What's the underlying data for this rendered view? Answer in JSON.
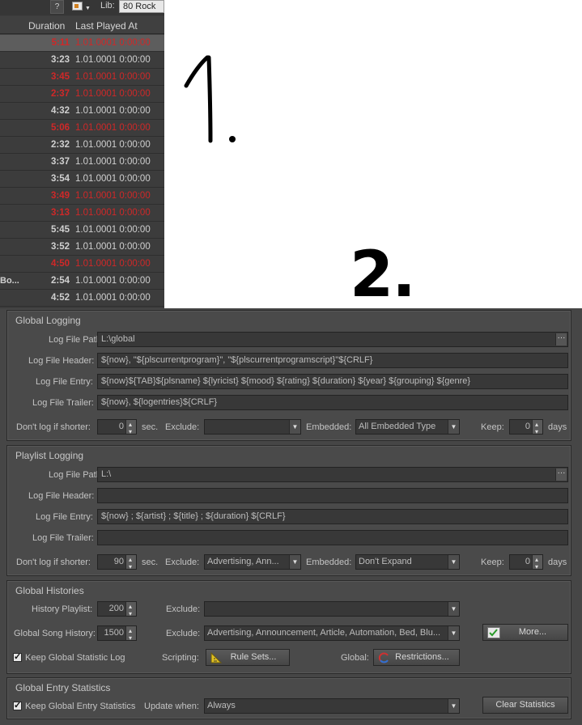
{
  "library": {
    "help_label": "?",
    "lib_label": "Lib:",
    "lib_value": "80 Rock",
    "columns": {
      "duration": "Duration",
      "last_played": "Last Played At"
    },
    "rows": [
      {
        "track": "",
        "duration": "5:11",
        "last_played": "1.01.0001 0:00:00",
        "red": true,
        "selected": true
      },
      {
        "track": "",
        "duration": "3:23",
        "last_played": "1.01.0001 0:00:00",
        "red": false
      },
      {
        "track": "",
        "duration": "3:45",
        "last_played": "1.01.0001 0:00:00",
        "red": true
      },
      {
        "track": "",
        "duration": "2:37",
        "last_played": "1.01.0001 0:00:00",
        "red": true
      },
      {
        "track": "",
        "duration": "4:32",
        "last_played": "1.01.0001 0:00:00",
        "red": false
      },
      {
        "track": "",
        "duration": "5:06",
        "last_played": "1.01.0001 0:00:00",
        "red": true
      },
      {
        "track": "",
        "duration": "2:32",
        "last_played": "1.01.0001 0:00:00",
        "red": false
      },
      {
        "track": "",
        "duration": "3:37",
        "last_played": "1.01.0001 0:00:00",
        "red": false
      },
      {
        "track": "",
        "duration": "3:54",
        "last_played": "1.01.0001 0:00:00",
        "red": false
      },
      {
        "track": "",
        "duration": "3:49",
        "last_played": "1.01.0001 0:00:00",
        "red": true
      },
      {
        "track": "",
        "duration": "3:13",
        "last_played": "1.01.0001 0:00:00",
        "red": true
      },
      {
        "track": "",
        "duration": "5:45",
        "last_played": "1.01.0001 0:00:00",
        "red": false
      },
      {
        "track": "",
        "duration": "3:52",
        "last_played": "1.01.0001 0:00:00",
        "red": false
      },
      {
        "track": "",
        "duration": "4:50",
        "last_played": "1.01.0001 0:00:00",
        "red": true
      },
      {
        "track": "Bo...",
        "duration": "2:54",
        "last_played": "1.01.0001 0:00:00",
        "red": false
      },
      {
        "track": "",
        "duration": "4:52",
        "last_played": "1.01.0001 0:00:00",
        "red": false
      }
    ]
  },
  "annotations": {
    "one": "1.",
    "two": "2."
  },
  "global_logging": {
    "title": "Global Logging",
    "path_label": "Log File Path:",
    "path": "L:\\global",
    "header_label": "Log File Header:",
    "header": "${now}, \"${plscurrentprogram}\", \"${plscurrentprogramscript}\"${CRLF}",
    "entry_label": "Log File Entry:",
    "entry": "${now}${TAB}${plsname}     ${lyricist} ${mood}  ${rating} ${duration}            ${year}   ${grouping}            ${genre}",
    "trailer_label": "Log File Trailer:",
    "trailer": "${now}, ${logentries}${CRLF}",
    "shorter_label": "Don't log if shorter:",
    "shorter": "0",
    "sec": "sec.",
    "exclude_label": "Exclude:",
    "exclude": "",
    "embedded_label": "Embedded:",
    "embedded": "All Embedded Type",
    "keep_label": "Keep:",
    "keep": "0",
    "days": "days"
  },
  "playlist_logging": {
    "title": "Playlist Logging",
    "path_label": "Log File Path:",
    "path": "L:\\",
    "header_label": "Log File Header:",
    "header": "",
    "entry_label": "Log File Entry:",
    "entry": "${now}  ;  ${artist}  ;  ${title}  ;  ${duration} ${CRLF}",
    "trailer_label": "Log File Trailer:",
    "trailer": "",
    "shorter_label": "Don't log if shorter:",
    "shorter": "90",
    "sec": "sec.",
    "exclude_label": "Exclude:",
    "exclude": "Advertising, Ann...",
    "embedded_label": "Embedded:",
    "embedded": "Don't Expand",
    "keep_label": "Keep:",
    "keep": "0",
    "days": "days"
  },
  "global_histories": {
    "title": "Global Histories",
    "history_playlist_label": "History Playlist:",
    "history_playlist": "200",
    "exclude1_label": "Exclude:",
    "exclude1": "",
    "song_history_label": "Global Song History:",
    "song_history": "1500",
    "exclude2_label": "Exclude:",
    "exclude2": "Advertising, Announcement, Article, Automation, Bed, Blu...",
    "more_button": "More...",
    "keep_stat_label": "Keep Global Statistic Log",
    "scripting_label": "Scripting:",
    "rule_sets_button": "Rule Sets...",
    "global_label": "Global:",
    "restrictions_button": "Restrictions..."
  },
  "global_entry_statistics": {
    "title": "Global Entry Statistics",
    "keep_label": "Keep Global Entry Statistics",
    "update_label": "Update when:",
    "update": "Always",
    "clear_button": "Clear Statistics"
  }
}
